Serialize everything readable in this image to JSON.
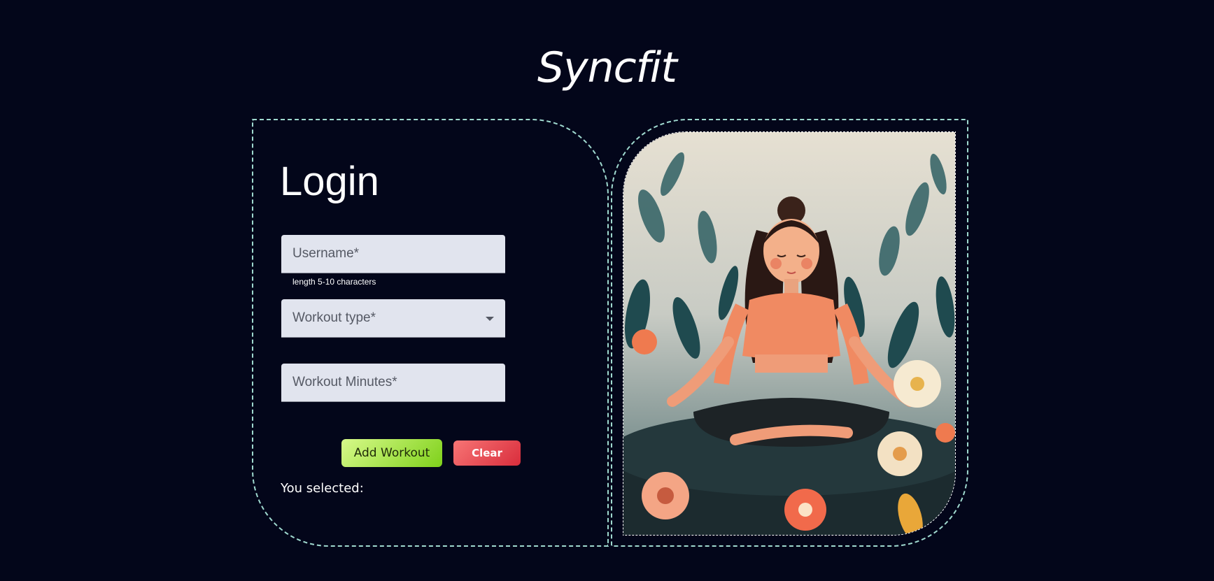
{
  "brand": {
    "title": "Syncfit"
  },
  "form": {
    "title": "Login",
    "username": {
      "placeholder": "Username*",
      "hint": "length 5-10 characters"
    },
    "workout_type": {
      "label": "Workout type*"
    },
    "workout_minutes": {
      "placeholder": "Workout Minutes*"
    },
    "add_button": "Add Workout",
    "clear_button": "Clear",
    "selected_label": "You selected:"
  },
  "colors": {
    "background": "#03061a",
    "card_border": "#9fd9cf",
    "field_bg": "#e1e4ee",
    "add_button": "#8fd62a",
    "clear_button": "#e33e48"
  },
  "icons": {
    "workout_type_toggle": "chevron-down-icon"
  }
}
